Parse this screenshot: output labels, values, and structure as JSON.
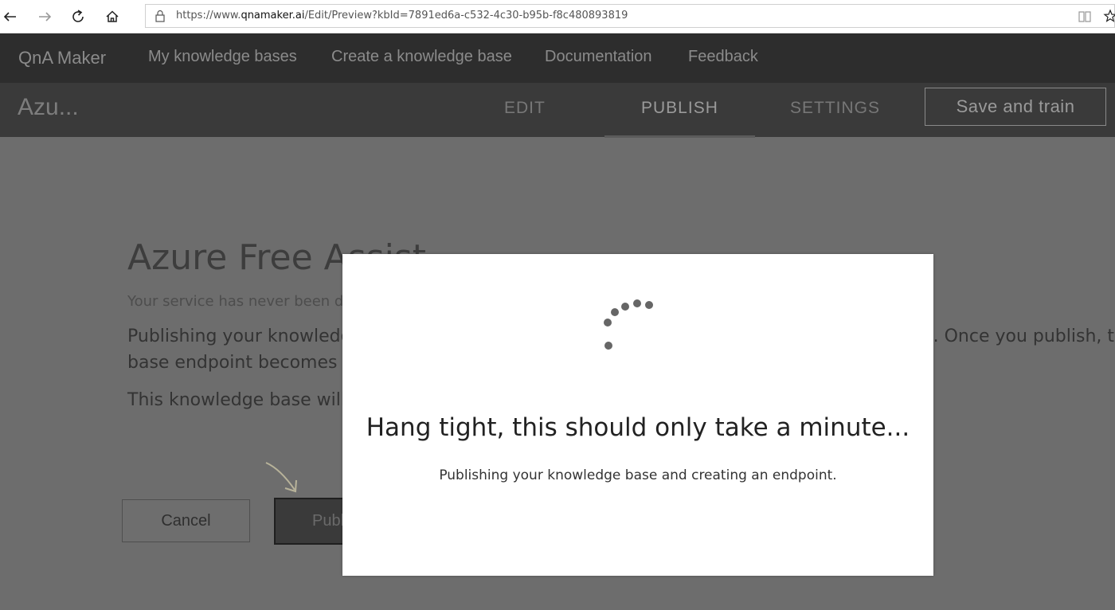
{
  "browser": {
    "url_prefix": "https://www.",
    "url_host": "qnamaker.ai",
    "url_path": "/Edit/Preview?kbId=7891ed6a-c532-4c30-b95b-f8c480893819"
  },
  "topnav": {
    "brand": "QnA Maker",
    "items": [
      "My knowledge bases",
      "Create a knowledge base",
      "Documentation",
      "Feedback"
    ]
  },
  "subnav": {
    "kb_title": "Azu...",
    "tabs": [
      "EDIT",
      "PUBLISH",
      "SETTINGS"
    ],
    "active_tab": "PUBLISH",
    "save_label": "Save and train"
  },
  "page": {
    "title": "Azure Free Assist",
    "deploy_status": "Your service has never been deployed.",
    "paragraph_line1_left": "Publishing your knowledg",
    "paragraph_line1_right": ". Once you publish, th",
    "paragraph_line2": "base endpoint becomes a",
    "paragraph2": "This knowledge base will",
    "cancel_label": "Cancel",
    "publish_label": "Publish"
  },
  "modal": {
    "title": "Hang tight, this should only take a minute...",
    "subtitle": "Publishing your knowledge base and creating an endpoint."
  },
  "colors": {
    "overlay": "#6d6d6d",
    "header_dark": "#2d2d2d",
    "modal_bg": "#ffffff",
    "spinner_dots": "#666666"
  }
}
